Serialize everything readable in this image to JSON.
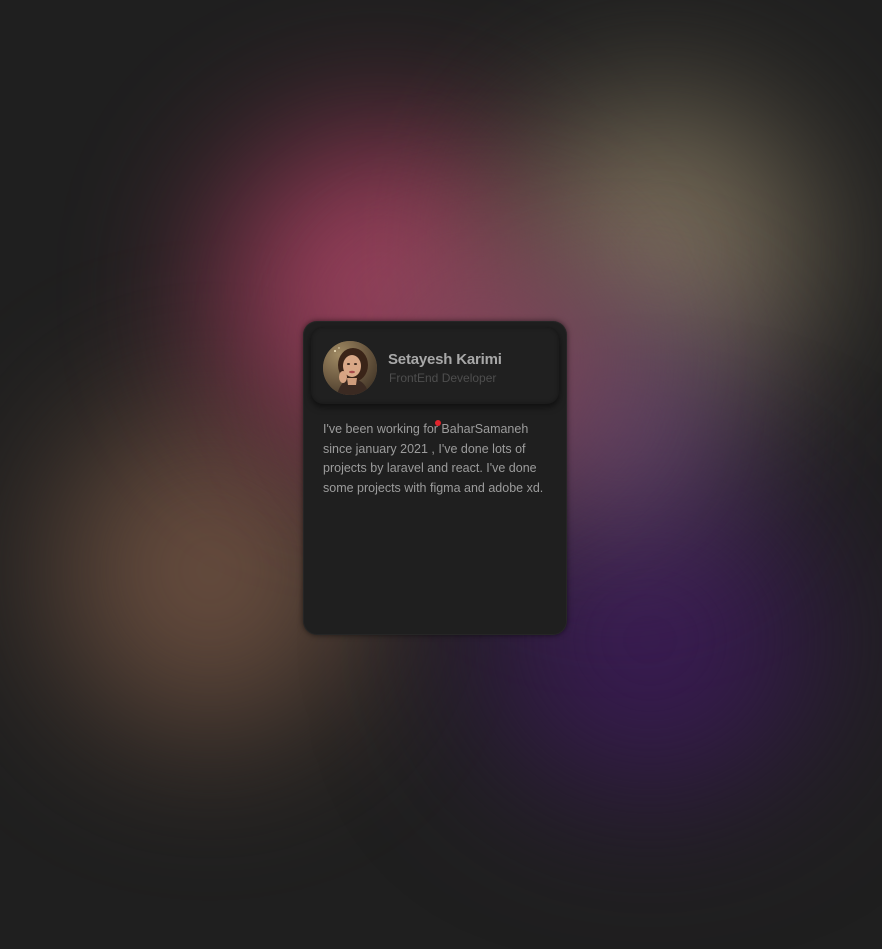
{
  "background": {
    "base_color": "#1f1f1f",
    "blob_colors": [
      "#b84e6e",
      "#8f806a",
      "#7a5a48",
      "#3e1c5a",
      "#7c5c86"
    ]
  },
  "profile_card": {
    "avatar_icon": "avatar-photo",
    "name": "Setayesh Karimi",
    "role": "FrontEnd Developer",
    "bio": "I've been working for BaharSamaneh since january 2021 , I've done lots of projects by laravel and react. I've done some projects with figma and adobe xd.",
    "colors": {
      "card_bg": "#1f1f1f",
      "name_text": "#a8a8a8",
      "role_text": "#4e4e4e",
      "bio_text": "#9c9c9c"
    }
  },
  "cursor": {
    "icon": "red-dot-cursor",
    "color": "#e0242c"
  }
}
